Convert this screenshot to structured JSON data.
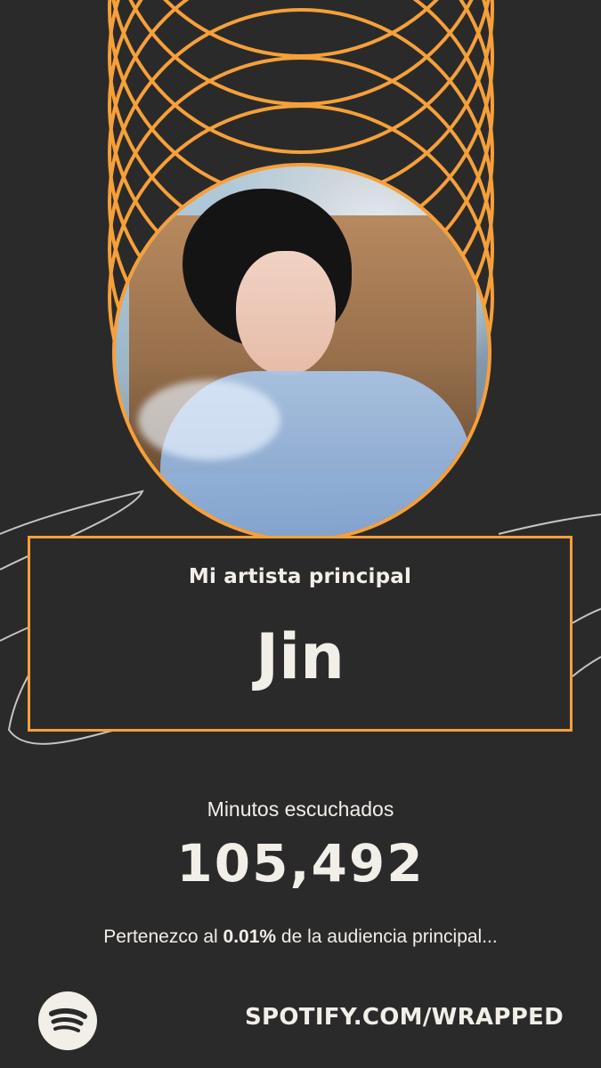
{
  "card": {
    "label": "Mi artista principal",
    "artist_name": "Jin"
  },
  "stats": {
    "minutes_label": "Minutos escuchados",
    "minutes_value": "105,492",
    "audience_prefix": "Pertenezco al ",
    "audience_percent": "0.01%",
    "audience_suffix": " de la audiencia principal..."
  },
  "footer": {
    "url": "SPOTIFY.COM/WRAPPED",
    "logo_icon": "spotify-logo-icon"
  },
  "colors": {
    "background": "#2b2a2a",
    "accent": "#f6a03a",
    "text": "#f2eee8"
  },
  "photo": {
    "icon": "artist-photo"
  }
}
